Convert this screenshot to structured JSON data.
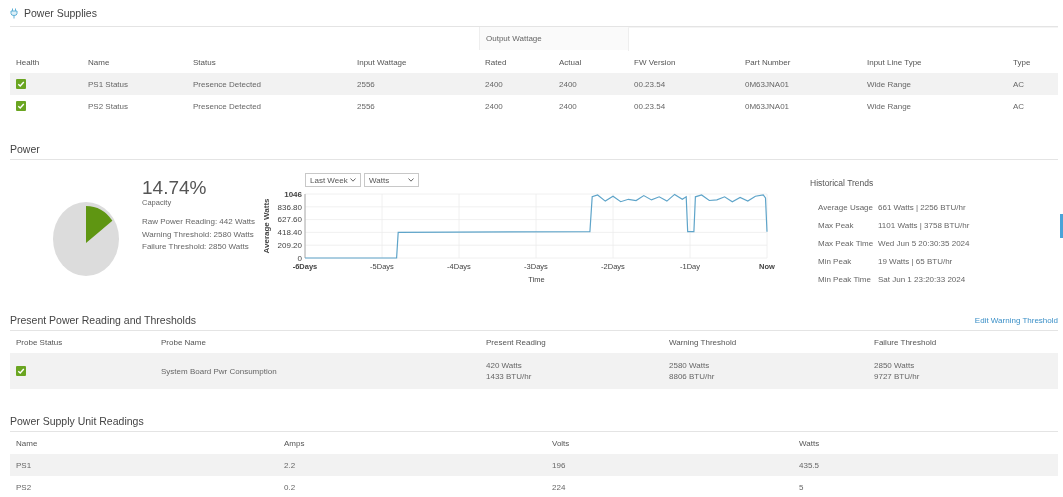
{
  "power_supplies": {
    "title": "Power Supplies",
    "group_header": "Output Wattage",
    "columns": [
      "Health",
      "Name",
      "Status",
      "Input Wattage",
      "Rated",
      "Actual",
      "FW Version",
      "Part Number",
      "Input Line Type",
      "Type"
    ],
    "rows": [
      {
        "cells": [
          {
            "healthy": true
          },
          "PS1 Status",
          "Presence Detected",
          "2556",
          "2400",
          "2400",
          "00.23.54",
          "0M63JNA01",
          "Wide Range",
          "AC"
        ]
      },
      {
        "cells": [
          {
            "healthy": true
          },
          "PS2 Status",
          "Presence Detected",
          "2556",
          "2400",
          "2400",
          "00.23.54",
          "0M63JNA01",
          "Wide Range",
          "AC"
        ]
      }
    ]
  },
  "power": {
    "title": "Power",
    "capacity": {
      "value": "14.74%",
      "label": "Capacity"
    },
    "readings": [
      "Raw Power Reading: 442 Watts",
      "Warning Threshold: 2580 Watts",
      "Failure Threshold: 2850 Watts"
    ],
    "range_select": {
      "value": "Last Week"
    },
    "unit_select": {
      "value": "Watts"
    },
    "chart_data": {
      "type": "line",
      "grid": true,
      "xlabel": "Time",
      "ylabel": "Average Watts",
      "x": [
        -6,
        -4.81,
        -4.79,
        -2.3,
        -2.27,
        -2.2,
        -2.1,
        -2.0,
        -1.9,
        -1.8,
        -1.7,
        -1.6,
        -1.5,
        -1.4,
        -1.3,
        -1.2,
        -1.1,
        -1.05,
        -1.03,
        -0.95,
        -0.93,
        -0.85,
        -0.75,
        -0.65,
        -0.55,
        -0.45,
        -0.35,
        -0.25,
        -0.15,
        -0.05,
        -0.02,
        0
      ],
      "series": [
        {
          "color": "#5ea4c9",
          "values": [
            0,
            0,
            420,
            430,
            1000,
            1030,
            930,
            1010,
            920,
            960,
            940,
            1020,
            950,
            1000,
            930,
            1040,
            960,
            1000,
            430,
            430,
            1000,
            1030,
            940,
            950,
            1000,
            920,
            990,
            930,
            1010,
            1030,
            980,
            430
          ]
        }
      ],
      "xlim": [
        -6,
        0
      ],
      "ylim": [
        0,
        1046
      ],
      "xticks": [
        {
          "value": -6,
          "label": "-6Days"
        },
        {
          "value": -5,
          "label": "-5Days"
        },
        {
          "value": -4,
          "label": "-4Days"
        },
        {
          "value": -3,
          "label": "-3Days"
        },
        {
          "value": -2,
          "label": "-2Days"
        },
        {
          "value": -1,
          "label": "-1Day"
        },
        {
          "value": 0,
          "label": "Now"
        }
      ],
      "yticks": [
        {
          "value": 0,
          "label": "0"
        },
        {
          "value": 209.2,
          "label": "209.20"
        },
        {
          "value": 418.4,
          "label": "418.40"
        },
        {
          "value": 627.6,
          "label": "627.60"
        },
        {
          "value": 836.8,
          "label": "836.80"
        },
        {
          "value": 1046,
          "label": "1046"
        }
      ]
    },
    "historical_trends": {
      "title": "Historical Trends",
      "rows": [
        {
          "label": "Average Usage",
          "value": "661 Watts | 2256 BTU/hr"
        },
        {
          "label": "Max Peak",
          "value": "1101 Watts | 3758 BTU/hr"
        },
        {
          "label": "Max Peak Time",
          "value": "Wed Jun 5 20:30:35 2024"
        },
        {
          "label": "Min Peak",
          "value": "19 Watts | 65 BTU/hr"
        },
        {
          "label": "Min Peak Time",
          "value": "Sat Jun 1 23:20:33 2024"
        }
      ]
    }
  },
  "thresholds": {
    "title": "Present Power Reading and Thresholds",
    "link": "Edit Warning Threshold",
    "columns": [
      "Probe Status",
      "Probe Name",
      "Present Reading",
      "Warning Threshold",
      "Failure Threshold"
    ],
    "rows": [
      {
        "cells": [
          {
            "healthy": true
          },
          "System Board Pwr Consumption",
          "420 Watts\n1433 BTU/hr",
          "2580 Watts\n8806 BTU/hr",
          "2850 Watts\n9727 BTU/hr"
        ]
      }
    ]
  },
  "psu_readings": {
    "title": "Power Supply Unit Readings",
    "columns": [
      "Name",
      "Amps",
      "Volts",
      "Watts"
    ],
    "rows": [
      [
        "PS1",
        "2.2",
        "196",
        "435.5"
      ],
      [
        "PS2",
        "0.2",
        "224",
        "5"
      ]
    ]
  }
}
